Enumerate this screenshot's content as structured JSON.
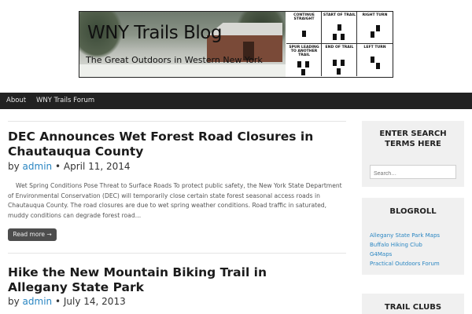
{
  "header": {
    "site_title": "WNY Trails Blog",
    "tagline": "The Great Outdoors in Western New York",
    "legend": [
      {
        "label": "CONTINUE STRAIGHT"
      },
      {
        "label": "START OF TRAIL"
      },
      {
        "label": "RIGHT TURN"
      },
      {
        "label": "SPUR LEADING TO ANOTHER TRAIL"
      },
      {
        "label": "END OF TRAIL"
      },
      {
        "label": "LEFT TURN"
      }
    ]
  },
  "nav": {
    "items": [
      {
        "label": "About"
      },
      {
        "label": "WNY Trails Forum"
      }
    ]
  },
  "posts": [
    {
      "title": "DEC Announces Wet Forest Road Closures in Chautauqua County",
      "by": "by",
      "author": "admin",
      "date": "• April 11, 2014",
      "excerpt": "Wet Spring Conditions Pose Threat to Surface Roads To protect public safety, the New York State Department of Environmental Conservation (DEC) will temporarily close certain state forest seasonal access roads in Chautauqua County. The road closures are due to wet spring weather conditions. Road traffic in saturated, muddy conditions can degrade forest road…",
      "read_more": "Read more →"
    },
    {
      "title": "Hike the New Mountain Biking Trail in Allegany State Park",
      "by": "by",
      "author": "admin",
      "date": "• July 14, 2013"
    }
  ],
  "sidebar": {
    "search": {
      "title": "ENTER SEARCH TERMS HERE",
      "placeholder": "Search…"
    },
    "blogroll": {
      "title": "BLOGROLL",
      "links": [
        {
          "label": "Allegany State Park Maps"
        },
        {
          "label": "Buffalo Hiking Club"
        },
        {
          "label": "G4Maps"
        },
        {
          "label": "Practical Outdoors Forum"
        }
      ]
    },
    "trail_clubs": {
      "title": "TRAIL CLUBS"
    }
  }
}
